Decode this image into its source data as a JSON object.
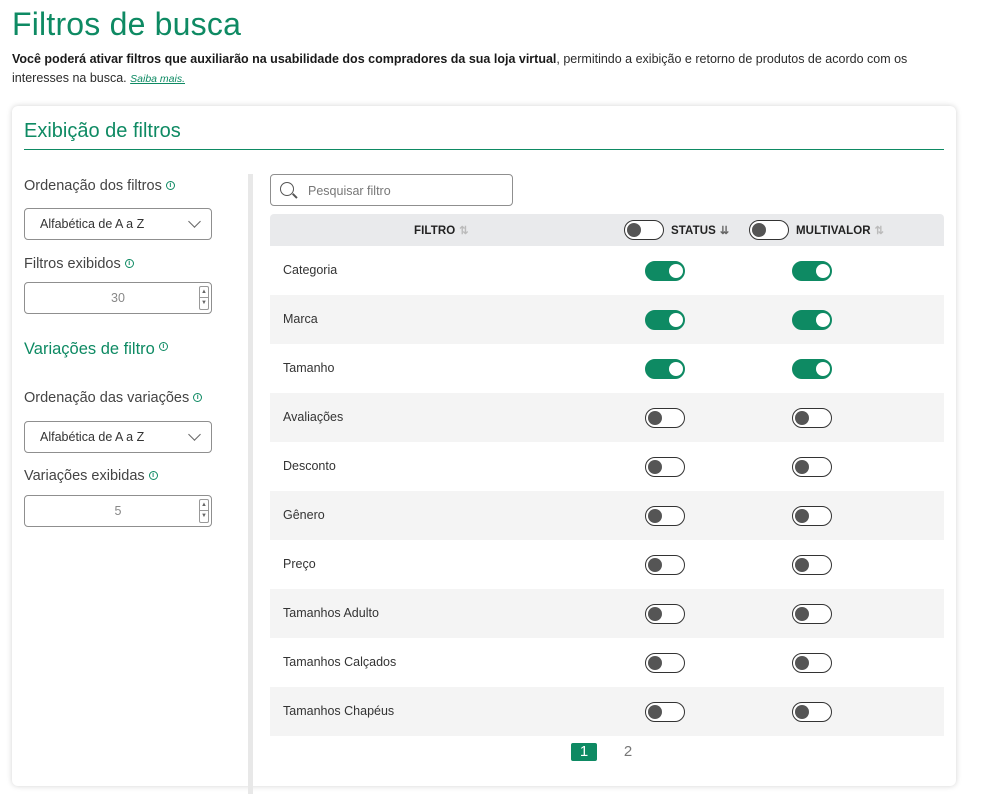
{
  "page": {
    "title": "Filtros de busca",
    "intro_bold": "Você poderá ativar filtros que auxiliarão na usabilidade dos compradores da sua loja virtual",
    "intro_rest": ", permitindo a exibição e retorno de produtos de acordo com os interesses na busca.",
    "learn_more": "Saiba mais."
  },
  "card": {
    "title": "Exibição de filtros"
  },
  "settings": {
    "filter_order_label": "Ordenação dos filtros",
    "filter_order_value": "Alfabética de A a Z",
    "filters_shown_label": "Filtros exibidos",
    "filters_shown_value": "30",
    "variations_heading": "Variações de filtro",
    "variation_order_label": "Ordenação das variações",
    "variation_order_value": "Alfabética de A a Z",
    "variations_shown_label": "Variações exibidas",
    "variations_shown_value": "5",
    "info_glyph": "i"
  },
  "search": {
    "placeholder": "Pesquisar filtro"
  },
  "table": {
    "col_filter": "FILTRO",
    "col_status": "STATUS",
    "col_multivalue": "MULTIVALOR",
    "header_status_toggle": false,
    "header_multivalue_toggle": false,
    "rows": [
      {
        "name": "Categoria",
        "status": true,
        "multivalue": true
      },
      {
        "name": "Marca",
        "status": true,
        "multivalue": true
      },
      {
        "name": "Tamanho",
        "status": true,
        "multivalue": true
      },
      {
        "name": "Avaliações",
        "status": false,
        "multivalue": false
      },
      {
        "name": "Desconto",
        "status": false,
        "multivalue": false
      },
      {
        "name": "Gênero",
        "status": false,
        "multivalue": false
      },
      {
        "name": "Preço",
        "status": false,
        "multivalue": false
      },
      {
        "name": "Tamanhos Adulto",
        "status": false,
        "multivalue": false
      },
      {
        "name": "Tamanhos Calçados",
        "status": false,
        "multivalue": false
      },
      {
        "name": "Tamanhos Chapéus",
        "status": false,
        "multivalue": false
      }
    ]
  },
  "pagination": {
    "pages": [
      "1",
      "2"
    ],
    "current": "1"
  },
  "colors": {
    "accent": "#0e8a63",
    "header_bg": "#e9eaec",
    "row_alt": "#f4f4f4"
  }
}
